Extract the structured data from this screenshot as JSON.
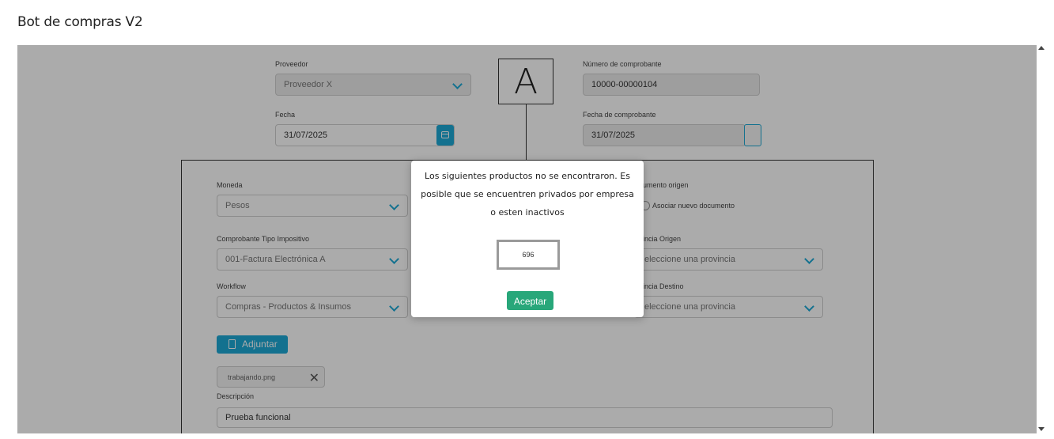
{
  "page": {
    "title": "Bot de compras V2"
  },
  "header": {
    "proveedor": {
      "label": "Proveedor",
      "value": "Proveedor X"
    },
    "fecha": {
      "label": "Fecha",
      "value": "31/07/2025"
    },
    "comprobante_letter": "A",
    "numero_comprobante": {
      "label": "Número de comprobante",
      "value": "10000-00000104"
    },
    "fecha_comprobante": {
      "label": "Fecha de comprobante",
      "value": "31/07/2025"
    }
  },
  "form": {
    "moneda": {
      "label": "Moneda",
      "value": "Pesos"
    },
    "documento_origen": {
      "label": "umento origen",
      "radio_label": "Asociar nuevo documento"
    },
    "comprobante_tipo": {
      "label": "Comprobante Tipo Impositivo",
      "value": "001-Factura Electrónica A"
    },
    "provincia_origen": {
      "label": "incia Origen",
      "placeholder": "eleccione una provincia"
    },
    "workflow": {
      "label": "Workflow",
      "value": "Compras - Productos & Insumos"
    },
    "provincia_destino": {
      "label": "incia Destino",
      "placeholder": "eleccione una provincia"
    },
    "adjuntar_label": "Adjuntar",
    "attachment_name": "trabajando.png",
    "descripcion": {
      "label": "Descripción",
      "value": "Prueba  funcional"
    }
  },
  "modal": {
    "message": "Los siguientes productos no se encontraron. Es posible que se encuentren privados por empresa o esten inactivos",
    "code": "696",
    "accept_label": "Aceptar"
  },
  "colors": {
    "accent": "#1da9d6",
    "success": "#28a77a",
    "overlay": "rgba(0,0,0,0.33)"
  }
}
